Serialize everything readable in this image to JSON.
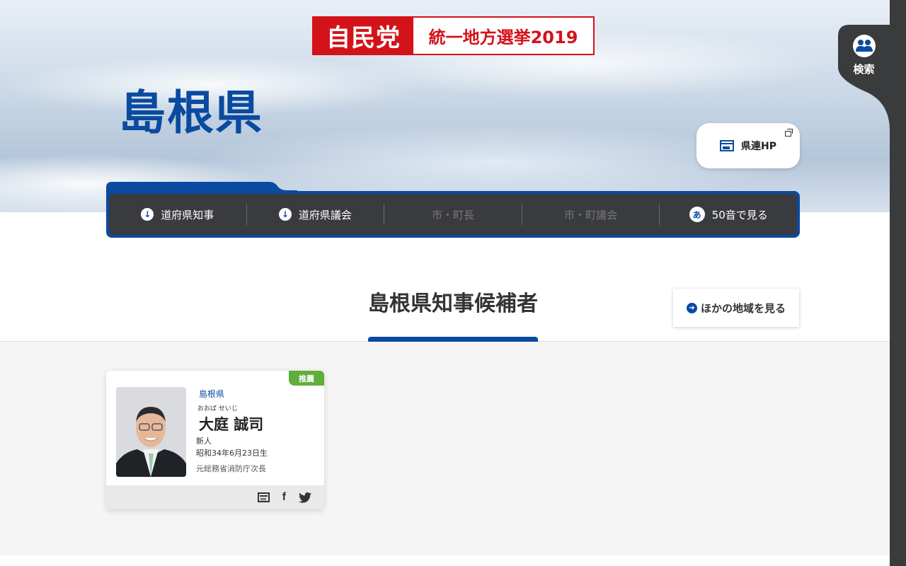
{
  "header": {
    "logo_party": "自民党",
    "logo_event": "統一地方選挙2019",
    "prefecture_title": "島根県",
    "search_label": "検索",
    "hp_button_label": "県連HP"
  },
  "nav": {
    "items": [
      {
        "label": "道府県知事",
        "icon": "arrow-down-circle-icon",
        "enabled": true
      },
      {
        "label": "道府県議会",
        "icon": "arrow-down-circle-icon",
        "enabled": true
      },
      {
        "label": "市・町長",
        "enabled": false
      },
      {
        "label": "市・町議会",
        "enabled": false
      },
      {
        "label": "50音で見る",
        "icon": "hiragana-a-icon",
        "icon_text": "あ",
        "enabled": true
      }
    ]
  },
  "section": {
    "title": "島根県知事候補者",
    "other_regions_label": "ほかの地域を見る"
  },
  "candidates": [
    {
      "badge": "推薦",
      "prefecture": "島根県",
      "kana": "おおば せいじ",
      "name": "大庭 誠司",
      "status": "新人",
      "birth": "昭和34年6月23日生",
      "career": "元総務省消防庁次長",
      "links": [
        "website",
        "facebook",
        "twitter"
      ]
    }
  ],
  "colors": {
    "accent_blue": "#0a4aa0",
    "party_red": "#d4121a",
    "badge_green": "#5fae3a",
    "nav_dark": "#3a3b3e"
  }
}
